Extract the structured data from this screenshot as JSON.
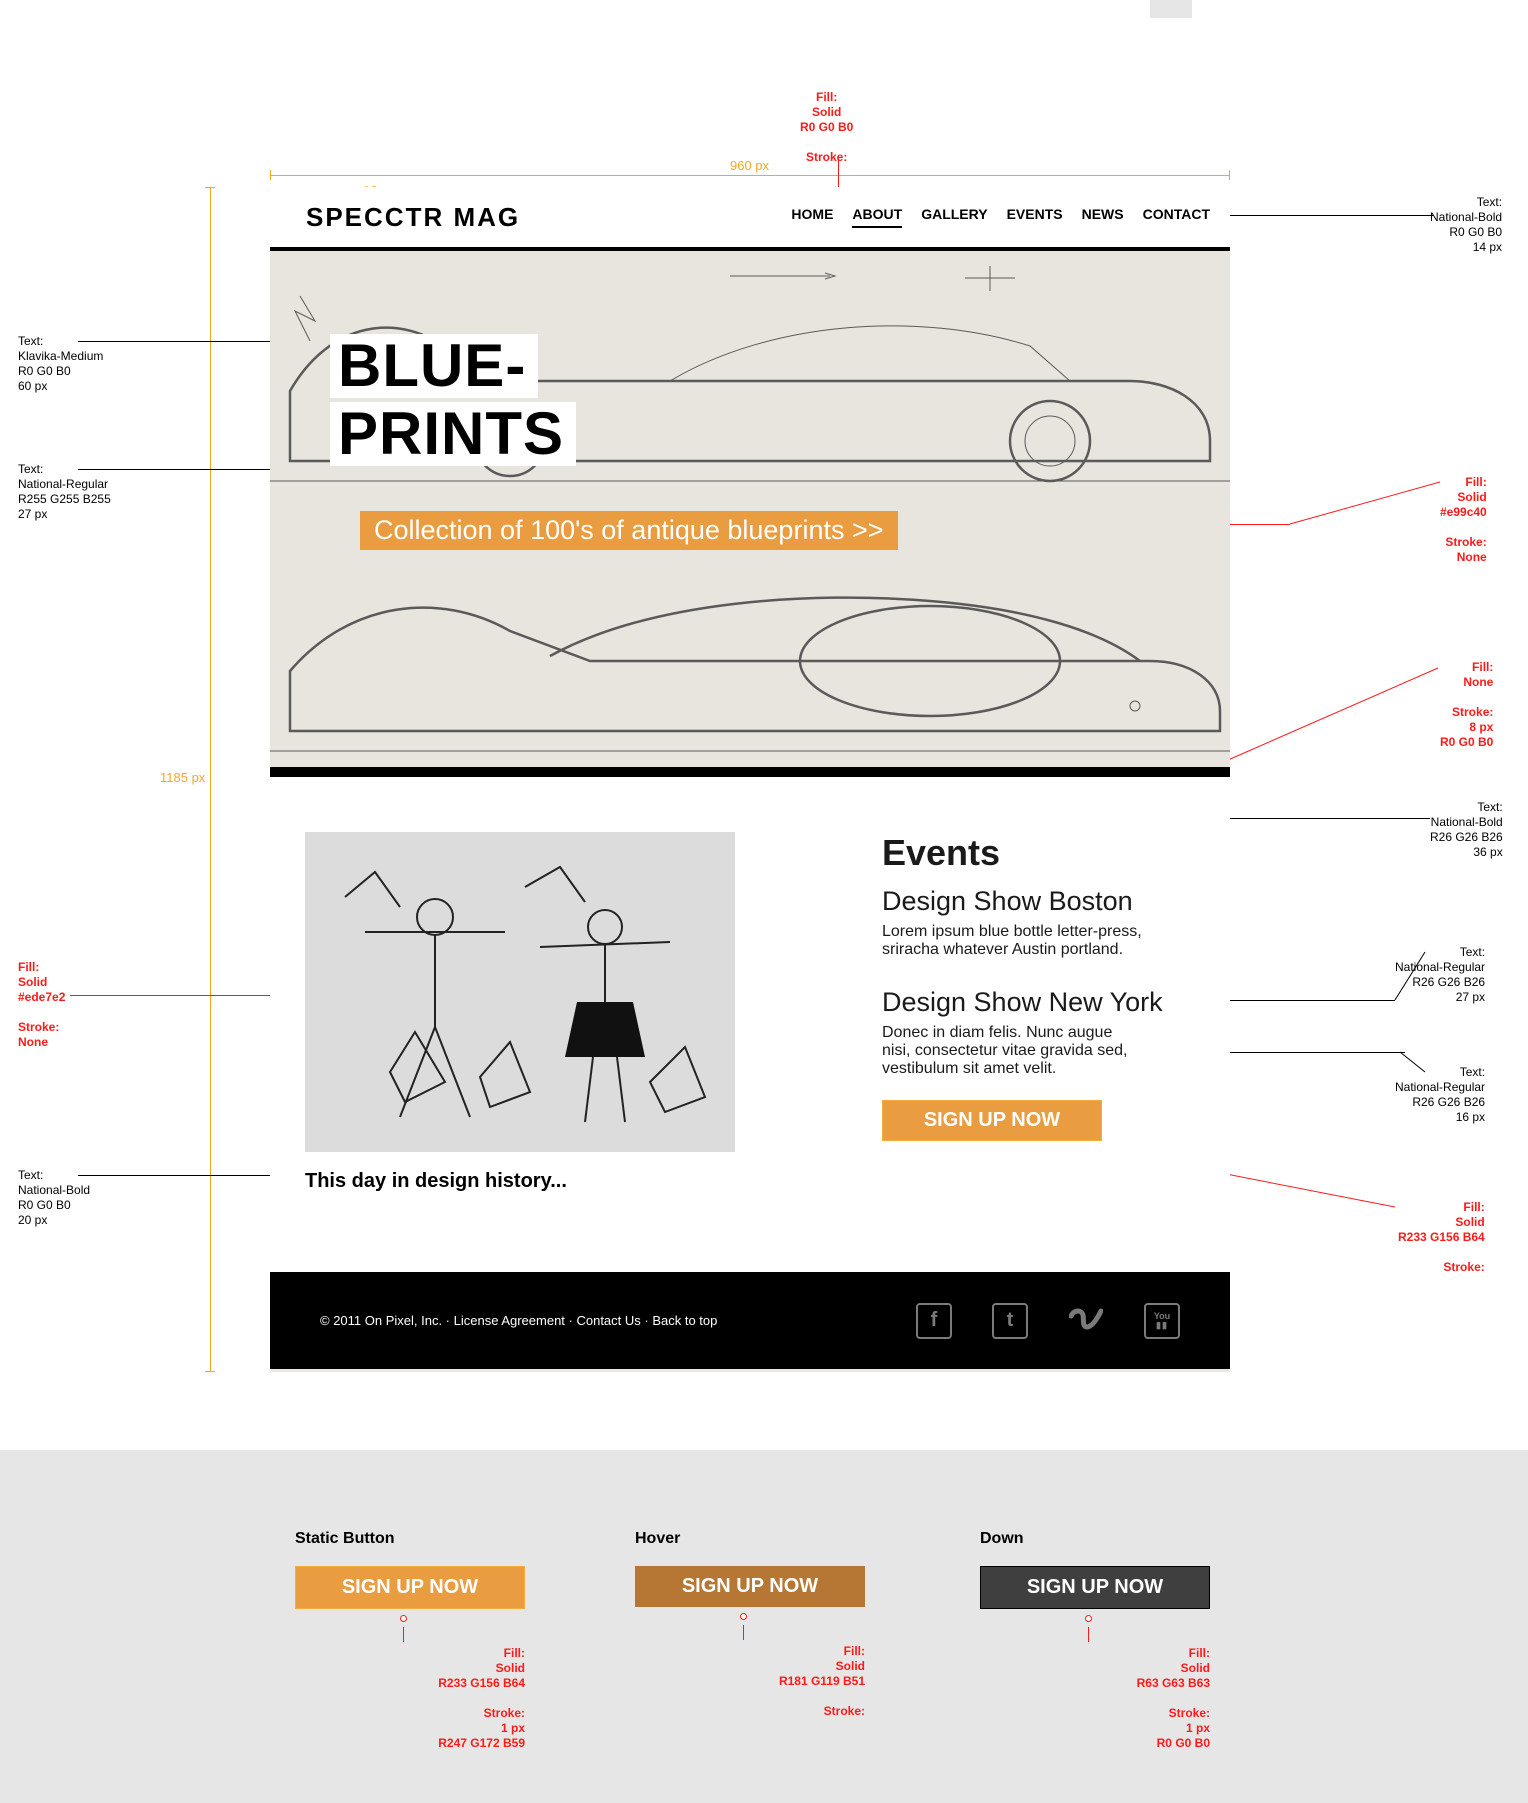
{
  "mockup": {
    "logo": "SPECCTR MAG",
    "nav": {
      "home": "HOME",
      "about": "ABOUT",
      "gallery": "GALLERY",
      "events": "EVENTS",
      "news": "NEWS",
      "contact": "CONTACT"
    },
    "hero": {
      "title_line1": "BLUE-",
      "title_line2": "PRINTS",
      "subtitle": "Collection of 100's of antique blueprints >>"
    },
    "content": {
      "caption": "This day in design history...",
      "events_heading": "Events",
      "event1_title": "Design Show Boston",
      "event1_body": "Lorem ipsum blue bottle letter-press, sriracha whatever Austin portland.",
      "event2_title": "Design Show New York",
      "event2_body": "Donec in diam felis. Nunc augue nisi, consectetur vitae gravida sed, vestibulum sit amet velit.",
      "signup_label": "SIGN UP NOW"
    },
    "footer": {
      "copyright": "© 2011 On Pixel, Inc. · License Agreement · Contact Us · Back to top"
    }
  },
  "dimensions": {
    "canvas_width": "960 px",
    "canvas_height": "1185 px",
    "logo_left": "36 px",
    "nav_gap_about": "16 px",
    "nav_gap_news": "19 px",
    "hero_top": "83 px",
    "content_top": "55 px",
    "content_gap": "137 px",
    "left_pad": "35 px",
    "events_pad": "44 px",
    "event_gap1": "51 px",
    "event_gap2": "54 px",
    "signup_left": "35 px",
    "caption_left": "50 px",
    "footer_h": "97 px"
  },
  "specs": {
    "about_link": "Fill:\nSolid\nR0 G0 B0\n\nStroke:",
    "nav_text": "Text:\nNational-Bold\nR0 G0 B0\n14 px",
    "hero_title": "Text:\nKlavika-Medium\nR0 G0 B0\n60 px",
    "hero_sub_text": "Text:\nNational-Regular\nR255 G255 B255\n27 px",
    "hero_sub_fill": "Fill:\nSolid\n#e99c40\n\nStroke:\nNone",
    "hero_border": "Fill:\nNone\n\nStroke:\n8 px\nR0 G0 B0",
    "events_h": "Text:\nNational-Bold\nR26 G26 B26\n36 px",
    "event_title": "Text:\nNational-Regular\nR26 G26 B26\n27 px",
    "event_body": "Text:\nNational-Regular\nR26 G26 B26\n16 px",
    "bg_fill": "Fill:\nSolid\n#ede7e2\n\nStroke:\nNone",
    "caption_text": "Text:\nNational-Bold\nR0 G0 B0\n20 px",
    "signup_fill": "Fill:\nSolid\nR233 G156 B64\n\nStroke:"
  },
  "states": {
    "static_h": "Static Button",
    "hover_h": "Hover",
    "down_h": "Down",
    "btn_label": "SIGN UP NOW",
    "static_spec": "Fill:\nSolid\nR233 G156 B64\n\nStroke:\n1 px\nR247 G172 B59",
    "hover_spec": "Fill:\nSolid\nR181 G119 B51\n\nStroke:",
    "down_spec": "Fill:\nSolid\nR63 G63 B63\n\nStroke:\n1 px\nR0 G0 B0"
  }
}
